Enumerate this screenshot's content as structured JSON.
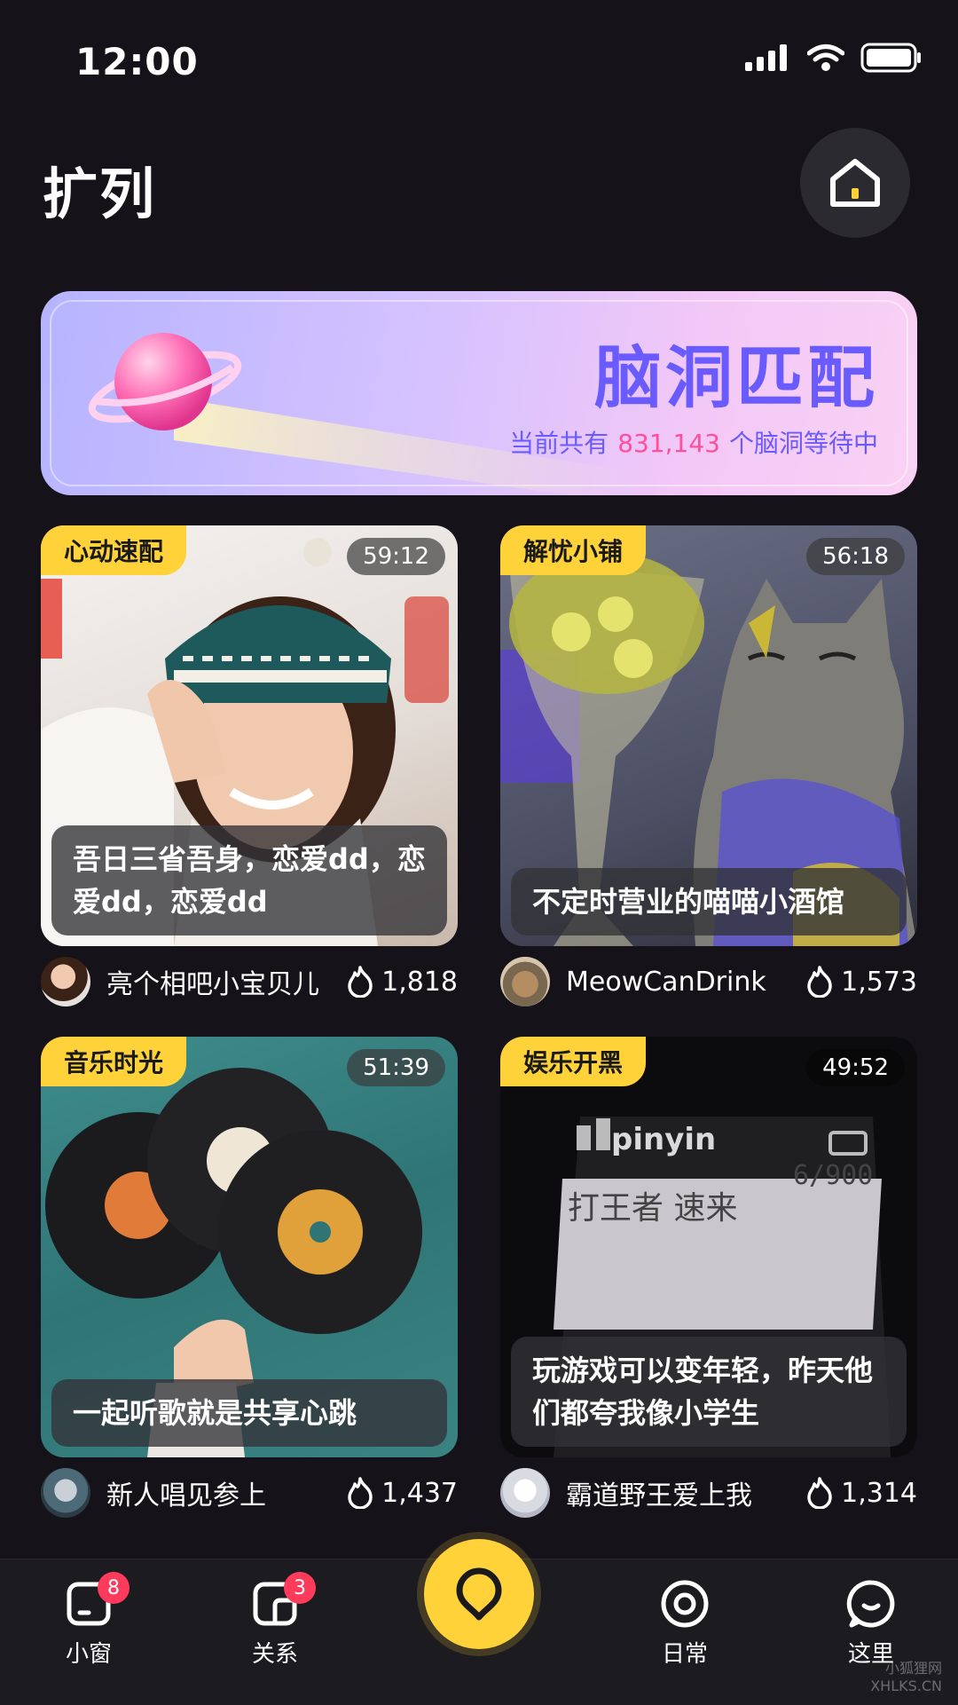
{
  "status": {
    "time": "12:00"
  },
  "header": {
    "title": "扩列"
  },
  "banner": {
    "title": "脑洞匹配",
    "subtitle_prefix": "当前共有",
    "count": "831,143",
    "subtitle_suffix": "个脑洞等待中"
  },
  "cards": [
    {
      "tag": "心动速配",
      "timer": "59:12",
      "caption": "吾日三省吾身，恋爱dd，恋爱dd，恋爱dd",
      "user": "亮个相吧小宝贝儿",
      "hot": "1,818"
    },
    {
      "tag": "解忧小铺",
      "timer": "56:18",
      "caption": "不定时营业的喵喵小酒馆",
      "user": "MeowCanDrink",
      "hot": "1,573"
    },
    {
      "tag": "音乐时光",
      "timer": "51:39",
      "caption": "一起听歌就是共享心跳",
      "user": "新人唱见参上",
      "hot": "1,437"
    },
    {
      "tag": "娱乐开黑",
      "timer": "49:52",
      "caption": "玩游戏可以变年轻，昨天他们都夸我像小学生",
      "user": "霸道野王爱上我",
      "hot": "1,314",
      "screen_text_1": "pinyin",
      "screen_text_2": "6/900",
      "screen_text_3": "打王者 速来"
    }
  ],
  "nav": {
    "items": [
      {
        "label": "小窗",
        "badge": "8"
      },
      {
        "label": "关系",
        "badge": "3"
      },
      {
        "label": "日常"
      },
      {
        "label": "这里"
      }
    ]
  },
  "watermark": {
    "line1": "小狐狸网",
    "line2": "XHLKS.CN"
  },
  "colors": {
    "accent": "#ffd23a",
    "banner_text": "#6a5bff",
    "count": "#ff4f9a",
    "badge": "#ff3b5c"
  }
}
